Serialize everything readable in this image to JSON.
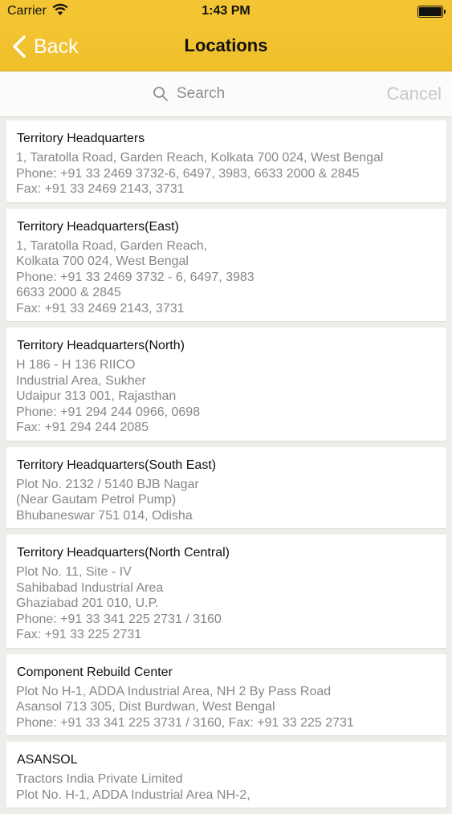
{
  "status_bar": {
    "carrier": "Carrier",
    "time": "1:43 PM"
  },
  "nav": {
    "back_label": "Back",
    "title": "Locations"
  },
  "search": {
    "placeholder": "Search",
    "cancel_label": "Cancel"
  },
  "locations": [
    {
      "title": "Territory Headquarters",
      "lines": [
        "1, Taratolla Road, Garden Reach, Kolkata 700 024, West Bengal",
        "Phone: +91 33 2469 3732-6, 6497, 3983, 6633 2000 & 2845",
        "Fax: +91 33 2469 2143, 3731"
      ]
    },
    {
      "title": "Territory Headquarters(East)",
      "lines": [
        "1, Taratolla Road, Garden Reach,",
        "Kolkata 700 024, West Bengal",
        "Phone: +91 33 2469 3732 - 6, 6497, 3983",
        "6633 2000 & 2845",
        "Fax: +91 33 2469 2143, 3731"
      ]
    },
    {
      "title": "Territory Headquarters(North)",
      "lines": [
        "H 186 - H 136 RIICO",
        "Industrial Area, Sukher",
        "Udaipur 313 001, Rajasthan",
        "Phone: +91 294 244 0966, 0698",
        "Fax: +91 294 244 2085"
      ]
    },
    {
      "title": "Territory Headquarters(South East)",
      "lines": [
        "Plot No. 2132 / 5140 BJB Nagar",
        "(Near Gautam Petrol Pump)",
        "Bhubaneswar 751 014, Odisha"
      ]
    },
    {
      "title": "Territory Headquarters(North Central)",
      "lines": [
        "Plot No. 11, Site - IV",
        "Sahibabad Industrial Area",
        "Ghaziabad 201 010, U.P.",
        "Phone: +91 33 341 225 2731 / 3160",
        "Fax: +91 33 225 2731"
      ]
    },
    {
      "title": "Component Rebuild Center",
      "lines": [
        "Plot No H-1, ADDA Industrial Area, NH 2 By Pass Road",
        "Asansol 713 305, Dist Burdwan, West Bengal",
        "Phone: +91 33 341 225 3731 / 3160, Fax: +91 33 225 2731"
      ]
    },
    {
      "title": "ASANSOL",
      "lines": [
        "Tractors India Private Limited",
        "Plot No. H-1, ADDA Industrial Area NH-2,"
      ]
    }
  ]
}
